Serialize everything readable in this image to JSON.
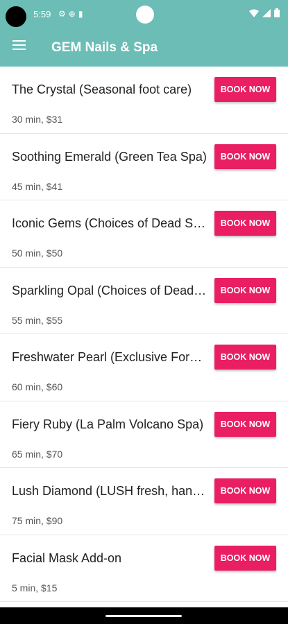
{
  "status_bar": {
    "time": "5:59",
    "left_icons": [
      "settings-icon",
      "globe-icon",
      "sim-icon"
    ],
    "right_icons": [
      "wifi-icon",
      "signal-icon",
      "battery-icon"
    ]
  },
  "app_bar": {
    "title": "GEM Nails & Spa",
    "menu_icon": "hamburger-menu-icon",
    "color": "#6bbdb5"
  },
  "accent_color": "#e91e63",
  "services": [
    {
      "name": "The Crystal (Seasonal foot care)",
      "meta": "30 min, $31",
      "button": "BOOK NOW"
    },
    {
      "name": "Soothing Emerald (Green Tea Spa)",
      "meta": "45 min, $41",
      "button": "BOOK NOW"
    },
    {
      "name": "Iconic Gems (Choices of Dead Sea)",
      "meta": "50 min, $50",
      "button": "BOOK NOW"
    },
    {
      "name": "Sparkling Opal (Choices of Dead Sea)",
      "meta": "55 min, $55",
      "button": "BOOK NOW"
    },
    {
      "name": "Freshwater Pearl (Exclusive Formula)",
      "meta": "60 min, $60",
      "button": "BOOK NOW"
    },
    {
      "name": "Fiery Ruby (La Palm Volcano Spa)",
      "meta": "65 min, $70",
      "button": "BOOK NOW"
    },
    {
      "name": "Lush Diamond (LUSH fresh, handmade)",
      "meta": "75 min, $90",
      "button": "BOOK NOW"
    },
    {
      "name": "Facial Mask Add-on",
      "meta": "5 min, $15",
      "button": "BOOK NOW"
    }
  ]
}
